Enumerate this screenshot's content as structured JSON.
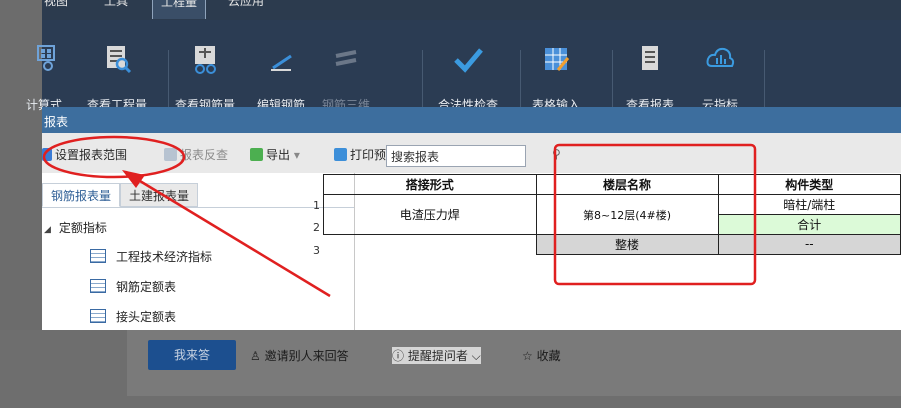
{
  "menu": {
    "tabs": [
      "视图",
      "工具",
      "工程量",
      "云应用"
    ]
  },
  "ribbon": {
    "buttons": [
      {
        "label": "计算式",
        "icon": "calc-icon"
      },
      {
        "label": "查看工程量",
        "icon": "view-quantity-icon"
      },
      {
        "label": "查看钢筋量",
        "icon": "view-rebar-icon"
      },
      {
        "label": "编辑钢筋",
        "icon": "edit-rebar-icon"
      },
      {
        "label": "钢筋三维",
        "icon": "rebar-3d-icon"
      },
      {
        "label": "合法性检查",
        "icon": "check-icon"
      },
      {
        "label": "表格输入",
        "icon": "table-input-icon"
      },
      {
        "label": "查看报表",
        "icon": "report-icon"
      },
      {
        "label": "云指标",
        "icon": "cloud-index-icon"
      }
    ]
  },
  "section": {
    "title": "报表"
  },
  "toolbar": {
    "set_range": "设置报表范围",
    "reverse_check": "报表反查",
    "export": "导出",
    "print_preview": "打印预览",
    "search_value": "搜索报表"
  },
  "left_panel": {
    "tabs": [
      "钢筋报表量",
      "土建报表量"
    ],
    "tree_root": "定额指标",
    "tree_items": [
      "工程技术经济指标",
      "钢筋定额表",
      "接头定额表"
    ]
  },
  "grid": {
    "headers": [
      "搭接形式",
      "楼层名称",
      "构件类型"
    ],
    "row_numbers": [
      "1",
      "2",
      "3"
    ],
    "connection": "电渣压力焊",
    "floor": "第8~12层(4#楼)",
    "whole": "整楼",
    "types": [
      "暗柱/端柱",
      "合计",
      "--"
    ]
  },
  "answer_bar": {
    "answer_button": "我来答",
    "invite": "邀请别人来回答",
    "remind": "提醒提问者",
    "collect": "收藏"
  },
  "colors": {
    "ribbon_bg": "#2b3c53",
    "section_bar": "#3d6e9e",
    "annotation_red": "#e02020",
    "total_row_green": "#dcfad8"
  }
}
